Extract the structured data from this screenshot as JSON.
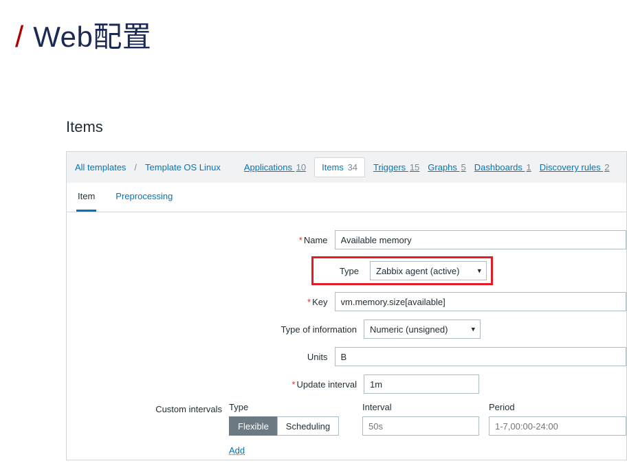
{
  "slide": {
    "title": "Web配置"
  },
  "page": {
    "title": "Items"
  },
  "breadcrumb": {
    "all_templates": "All templates",
    "template_name": "Template OS Linux"
  },
  "host_nav": [
    {
      "label": "Applications",
      "count": "10"
    },
    {
      "label": "Items",
      "count": "34"
    },
    {
      "label": "Triggers",
      "count": "15"
    },
    {
      "label": "Graphs",
      "count": "5"
    },
    {
      "label": "Dashboards",
      "count": "1"
    },
    {
      "label": "Discovery rules",
      "count": "2"
    }
  ],
  "tabs": {
    "item": "Item",
    "preprocessing": "Preprocessing"
  },
  "form": {
    "name_label": "Name",
    "name_value": "Available memory",
    "type_label": "Type",
    "type_value": "Zabbix agent (active)",
    "key_label": "Key",
    "key_value": "vm.memory.size[available]",
    "info_label": "Type of information",
    "info_value": "Numeric (unsigned)",
    "units_label": "Units",
    "units_value": "B",
    "update_label": "Update interval",
    "update_value": "1m",
    "custom_label": "Custom intervals",
    "ci_headers": {
      "type": "Type",
      "interval": "Interval",
      "period": "Period"
    },
    "ci_seg": {
      "flexible": "Flexible",
      "scheduling": "Scheduling"
    },
    "ci_interval_placeholder": "50s",
    "ci_period_placeholder": "1-7,00:00-24:00",
    "add": "Add"
  }
}
